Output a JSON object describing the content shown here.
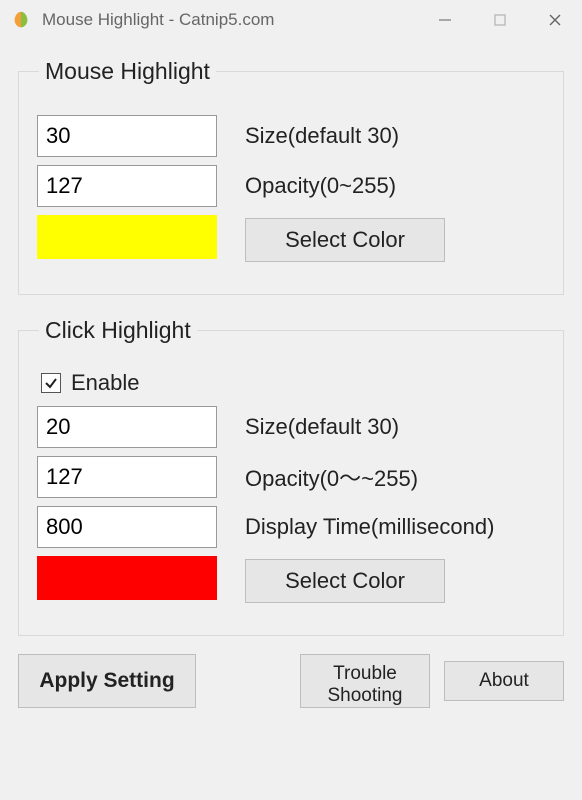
{
  "window": {
    "title": "Mouse Highlight - Catnip5.com"
  },
  "group_mouse": {
    "legend": "Mouse Highlight",
    "size_value": "30",
    "size_label": "Size(default 30)",
    "opacity_value": "127",
    "opacity_label": "Opacity(0~255)",
    "color": "#ffff00",
    "select_color_label": "Select Color"
  },
  "group_click": {
    "legend": "Click Highlight",
    "enable_label": "Enable",
    "enable_checked": true,
    "size_value": "20",
    "size_label": "Size(default 30)",
    "opacity_value": "127",
    "opacity_label": "Opacity(0～~255)",
    "display_time_value": "800",
    "display_time_label": "Display Time(millisecond)",
    "color": "#ff0000",
    "select_color_label": "Select Color"
  },
  "buttons": {
    "apply": "Apply Setting",
    "trouble": "Trouble\nShooting",
    "about": "About"
  }
}
